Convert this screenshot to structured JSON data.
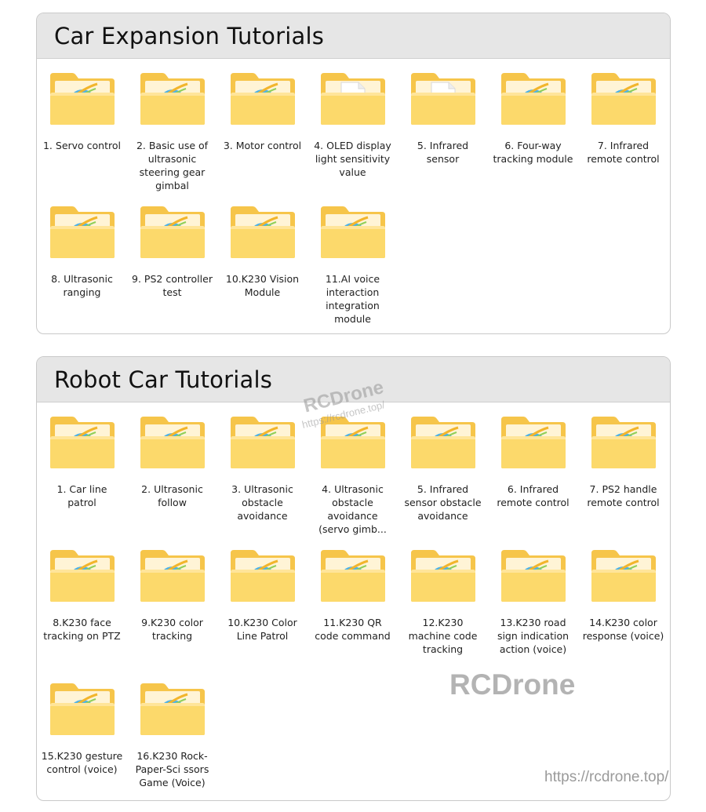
{
  "sections": [
    {
      "title": "Car Expansion Tutorials",
      "items": [
        {
          "label": "1. Servo control",
          "icon": "folder-browser-icon"
        },
        {
          "label": "2. Basic use of ultrasonic steering gear gimbal",
          "icon": "folder-browser-icon"
        },
        {
          "label": "3. Motor control",
          "icon": "folder-browser-icon"
        },
        {
          "label": "4. OLED display light sensitivity value",
          "icon": "folder-document-icon"
        },
        {
          "label": "5. Infrared sensor",
          "icon": "folder-document-icon"
        },
        {
          "label": "6. Four-way tracking module",
          "icon": "folder-browser-icon"
        },
        {
          "label": "7. Infrared remote control",
          "icon": "folder-browser-icon"
        },
        {
          "label": "8. Ultrasonic ranging",
          "icon": "folder-browser-icon"
        },
        {
          "label": "9. PS2 controller test",
          "icon": "folder-browser-icon"
        },
        {
          "label": "10.K230 Vision Module",
          "icon": "folder-browser-icon"
        },
        {
          "label": "11.AI voice interaction integration module",
          "icon": "folder-browser-icon"
        }
      ]
    },
    {
      "title": "Robot Car Tutorials",
      "items": [
        {
          "label": "1. Car line patrol",
          "icon": "folder-browser-icon"
        },
        {
          "label": "2. Ultrasonic follow",
          "icon": "folder-browser-icon"
        },
        {
          "label": "3. Ultrasonic obstacle avoidance",
          "icon": "folder-browser-icon"
        },
        {
          "label": "4. Ultrasonic obstacle avoidance (servo gimb...",
          "icon": "folder-browser-icon"
        },
        {
          "label": "5. Infrared sensor obstacle avoidance",
          "icon": "folder-browser-icon"
        },
        {
          "label": "6. Infrared remote control",
          "icon": "folder-browser-icon"
        },
        {
          "label": "7. PS2 handle remote control",
          "icon": "folder-browser-icon"
        },
        {
          "label": "8.K230 face tracking on PTZ",
          "icon": "folder-browser-icon"
        },
        {
          "label": "9.K230 color tracking",
          "icon": "folder-browser-icon"
        },
        {
          "label": "10.K230 Color Line Patrol",
          "icon": "folder-browser-icon"
        },
        {
          "label": "11.K230 QR code command",
          "icon": "folder-browser-icon"
        },
        {
          "label": "12.K230 machine code tracking",
          "icon": "folder-browser-icon"
        },
        {
          "label": "13.K230 road sign indication action (voice)",
          "icon": "folder-browser-icon"
        },
        {
          "label": "14.K230 color response (voice)",
          "icon": "folder-browser-icon"
        },
        {
          "label": "15.K230 gesture control (voice)",
          "icon": "folder-browser-icon"
        },
        {
          "label": "16.K230 Rock-Paper-Sci ssors Game (Voice)",
          "icon": "folder-browser-icon"
        }
      ]
    }
  ],
  "watermarks": {
    "diagonal_brand": "RCDrone",
    "diagonal_url": "https://rcdrone.top/",
    "brand": "RCDrone",
    "url": "https://rcdrone.top/"
  },
  "colors": {
    "folder_back": "#f6c54a",
    "folder_front": "#fcd96b",
    "header_bg": "#e6e6e6",
    "border": "#c9c9c9"
  }
}
